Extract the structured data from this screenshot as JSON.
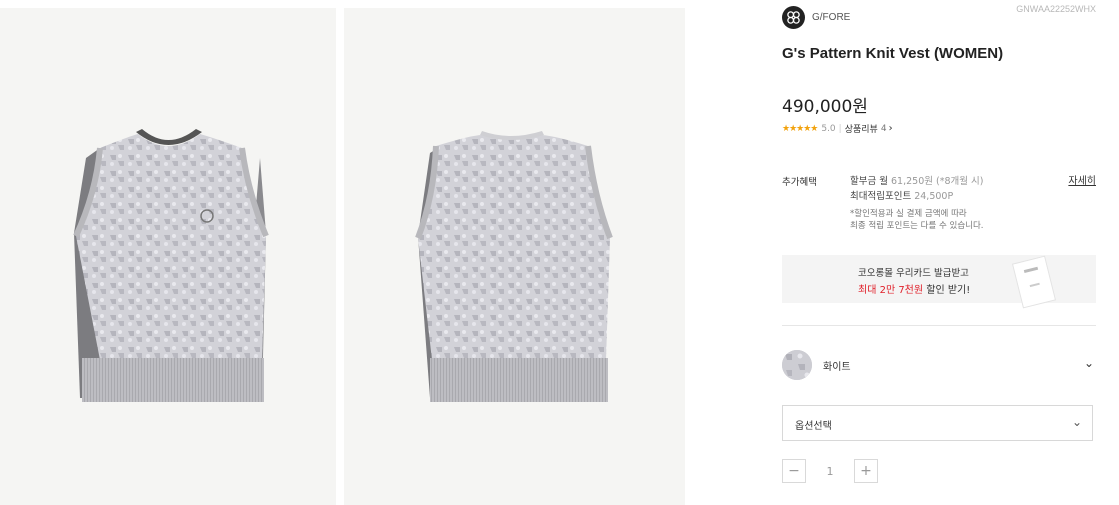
{
  "product": {
    "brand": "G/FORE",
    "code": "GNWAA22252WHX",
    "title": "G's Pattern Knit Vest (WOMEN)",
    "price": "490,000원",
    "stars": "★★★★★",
    "rating": "5.0",
    "review_label": "상품리뷰",
    "review_count": "4",
    "review_chevron": "›"
  },
  "benefits": {
    "label": "추가혜택",
    "installment_prefix": "할부금 월",
    "installment_amount": "61,250원 (*8개월 시)",
    "points_prefix": "최대적립포인트",
    "points_value": "24,500P",
    "note_line1": "*할인적용과 실 결제 금액에 따라",
    "note_line2": "최종 적립 포인트는 다를 수 있습니다.",
    "detail_link": "자세히"
  },
  "banner": {
    "line1": "코오롱몰 우리카드 발급받고",
    "line2_red": "최대 2만 7천원",
    "line2_rest": " 할인 받기!"
  },
  "color_option": {
    "name": "화이트",
    "chevron": "⌄"
  },
  "option_select": {
    "label": "옵션선택",
    "chevron": "⌄"
  },
  "quantity": {
    "minus": "−",
    "value": "1",
    "plus": "+"
  },
  "icons": {
    "brand_logo": "gfore-logo-icon",
    "stars": "star-icon",
    "dropdown": "chevron-down-icon"
  },
  "colors": {
    "star": "#f2a20d",
    "accent_red": "#e0202a",
    "image_bg": "#f5f5f3",
    "vest_knit": "#d4d4da"
  }
}
